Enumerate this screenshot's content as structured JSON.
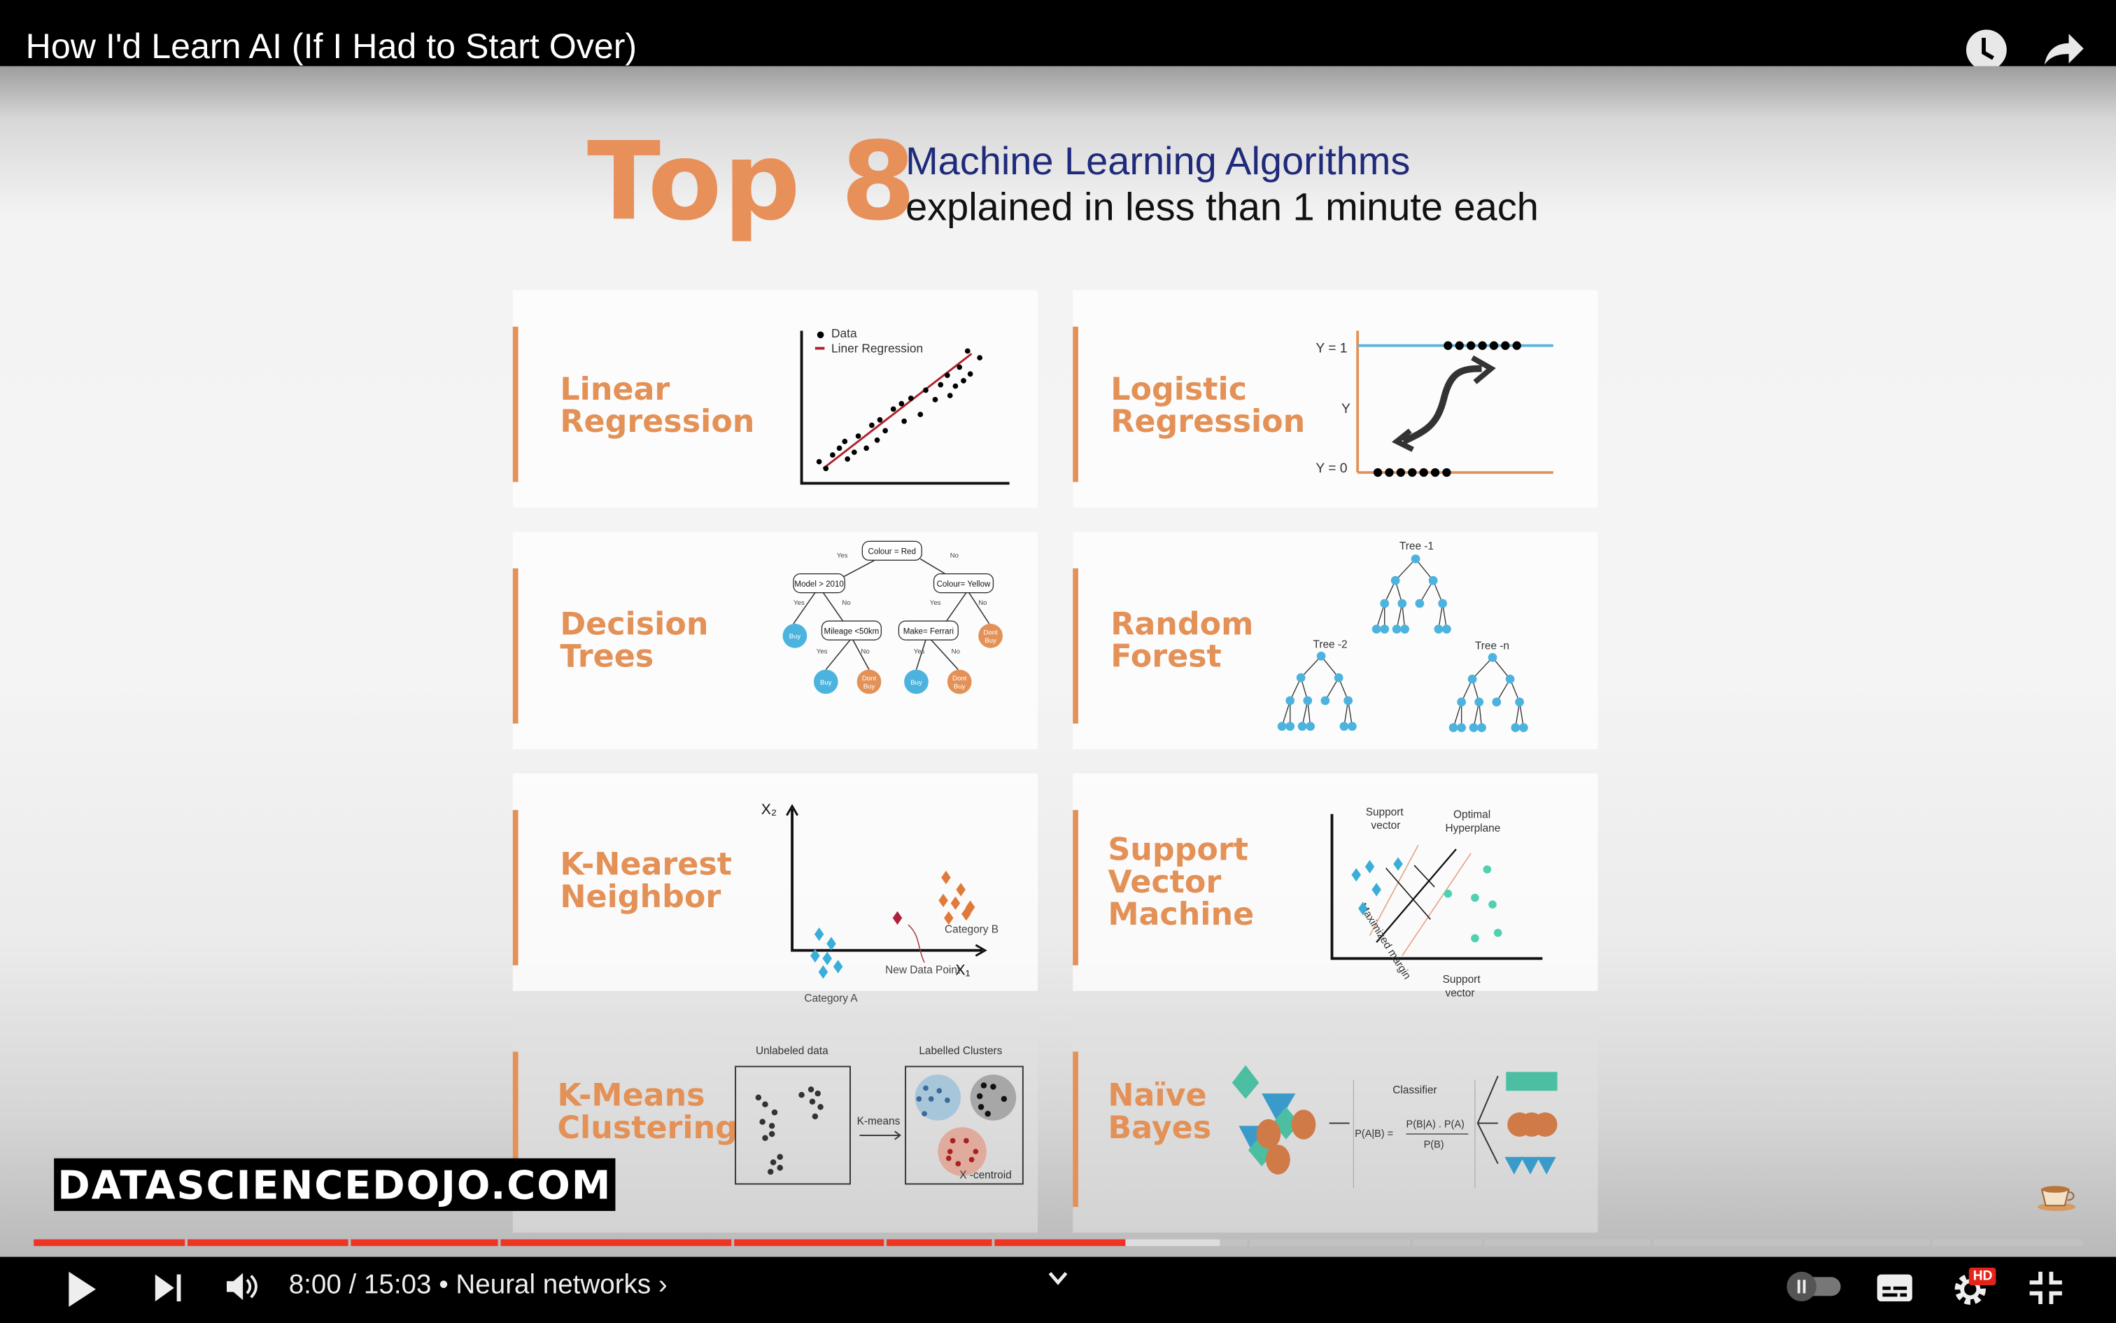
{
  "video": {
    "title": "How I'd Learn AI (If I Had to Start Over)",
    "time_current": "8:00",
    "time_total": "15:03",
    "time_display": "8:00 / 15:03",
    "chapter": "Neural networks",
    "progress_percent": 53.3,
    "buffered_percent": 57.9,
    "hd_badge": "HD",
    "watermark": "DATASCIENCEDOJO.COM",
    "icons": [
      "watch-later-icon",
      "share-icon",
      "play-icon",
      "next-icon",
      "volume-icon",
      "chevron-down-icon",
      "autoplay-toggle",
      "captions-icon",
      "settings-icon",
      "exit-fullscreen-icon",
      "coffee-cup-icon"
    ],
    "accent_color": "#ee3524"
  },
  "slide": {
    "title_big": "Top 8",
    "title_line1": "Machine Learning Algorithms",
    "title_line2": "explained in less than 1 minute each",
    "cards": [
      {
        "title1": "Linear",
        "title2": "Regression",
        "legend_data": "Data",
        "legend_line": "Liner Regression"
      },
      {
        "title1": "Logistic",
        "title2": "Regression",
        "y1": "Y = 1",
        "y": "Y",
        "y0": "Y = 0"
      },
      {
        "title1": "Decision",
        "title2": "Trees",
        "root": "Colour = Red",
        "n_left": "Model > 2010",
        "n_right": "Colour= Yellow",
        "n_mileage": "Mileage <50km",
        "n_make": "Make= Ferrari",
        "buy": "Buy",
        "dont": "Dont",
        "dont2": "Buy",
        "yes": "Yes",
        "no": "No"
      },
      {
        "title1": "Random",
        "title2": "Forest",
        "t1": "Tree -1",
        "t2": "Tree -2",
        "tn": "Tree -n"
      },
      {
        "title1": "K-Nearest",
        "title2": "Neighbor",
        "x2": "X₂",
        "x1": "X₁",
        "cat_b": "Category B",
        "new_point": "New Data Point",
        "cat_a": "Category A"
      },
      {
        "title1": "Support",
        "title2": "Vector",
        "title3": "Machine",
        "sv1a": "Support",
        "sv1b": "vector",
        "oh1": "Optimal",
        "oh2": "Hyperplane",
        "sv2a": "Support",
        "sv2b": "vector",
        "margin": "Maximized margin"
      },
      {
        "title1": "K-Means",
        "title2": "Clustering",
        "unlabeled": "Unlabeled data",
        "labelled": "Labelled Clusters",
        "kmeans": "K-means",
        "centroid": "X -centroid"
      },
      {
        "title1": "Naïve",
        "title2": "Bayes",
        "classifier": "Classifier",
        "formula_lhs": "P(A|B) =",
        "formula_num": "P(B|A) . P(A)",
        "formula_den": "P(B)"
      }
    ]
  }
}
